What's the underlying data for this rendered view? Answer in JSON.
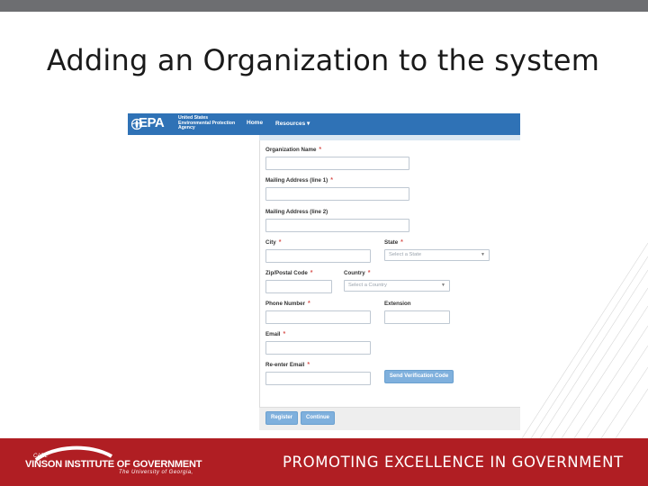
{
  "slide": {
    "title": "Adding an Organization to the system",
    "colors": {
      "top_bar": "#6d6e71",
      "banner": "#b01e23",
      "nav": "#2f72b6",
      "required": "#d9534f"
    }
  },
  "epa_header": {
    "logo_text": "EPA",
    "agency_lines": [
      "United States",
      "Environmental Protection",
      "Agency"
    ],
    "nav": {
      "home": "Home",
      "resources": "Resources ▾"
    }
  },
  "form": {
    "required_mark": "*",
    "org_name_label": "Organization Name",
    "mailing1_label": "Mailing Address (line 1)",
    "mailing2_label": "Mailing Address (line 2)",
    "city_label": "City",
    "state_label": "State",
    "state_placeholder": "Select a State",
    "zip_label": "Zip/Postal Code",
    "country_label": "Country",
    "country_placeholder": "Select a Country",
    "phone_label": "Phone Number",
    "extension_label": "Extension",
    "email_label": "Email",
    "reenter_email_label": "Re-enter Email",
    "send_code_button": "Send Verification Code",
    "register_button": "Register",
    "continue_button": "Continue"
  },
  "footer": {
    "org_small": "CARL",
    "org_name": "VINSON INSTITUTE OF GOVERNMENT",
    "org_sub": "The University of Georgia,",
    "tagline": "PROMOTING EXCELLENCE IN GOVERNMENT"
  }
}
